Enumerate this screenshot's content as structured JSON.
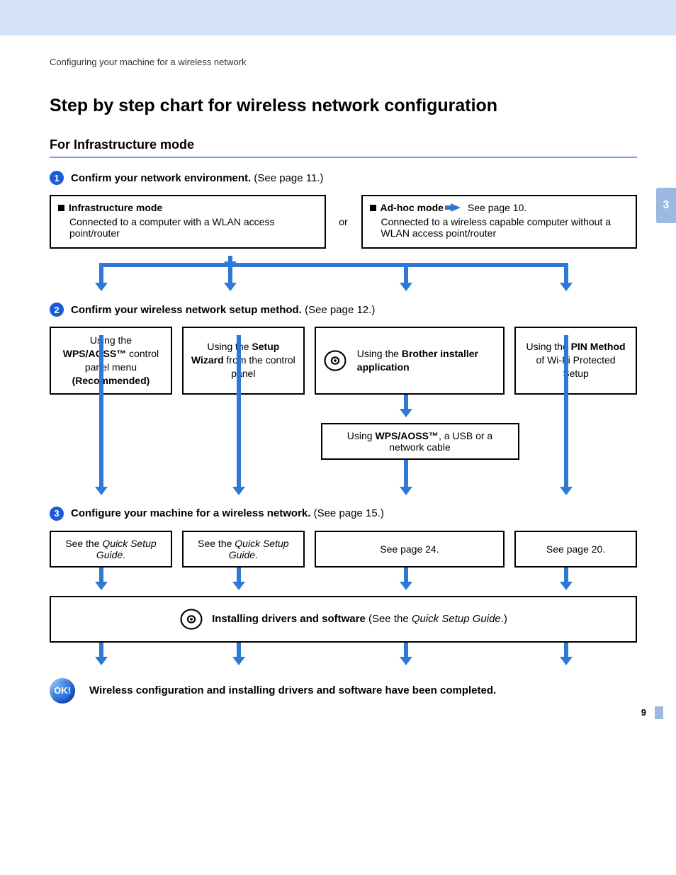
{
  "breadcrumb": "Configuring your machine for a wireless network",
  "page_title": "Step by step chart for wireless network configuration",
  "section_title": "For Infrastructure mode",
  "side_tab": "3",
  "page_number": "9",
  "step1": {
    "num": "1",
    "label_bold": "Confirm your network environment.",
    "label_rest": " (See page 11.)",
    "box_left_title": "Infrastructure mode",
    "box_left_body": "Connected to a computer with a WLAN access point/router",
    "or": "or",
    "box_right_title": "Ad-hoc mode",
    "box_right_see": " See page 10.",
    "box_right_body": "Connected to a wireless capable computer without a WLAN access point/router"
  },
  "step2": {
    "num": "2",
    "label_bold": "Confirm your wireless network setup method.",
    "label_rest": " (See page 12.)",
    "opt1_pre": "Using the ",
    "opt1_bold": "WPS/AOSS™",
    "opt1_mid": " control panel menu ",
    "opt1_rec": "(Recommended)",
    "opt2_pre": "Using the ",
    "opt2_bold": "Setup Wizard",
    "opt2_post": " from the control panel",
    "opt3_pre": "Using the ",
    "opt3_bold": "Brother installer application",
    "opt4_pre": "Using the ",
    "opt4_bold": "PIN Method",
    "opt4_post": " of Wi-Fi Protected Setup",
    "sub_pre": "Using ",
    "sub_bold": "WPS/AOSS™",
    "sub_post": ", a USB or a network cable"
  },
  "step3": {
    "num": "3",
    "label_bold": "Configure your machine for a wireless network.",
    "label_rest": " (See page 15.)",
    "c1_pre": "See the ",
    "c1_it": "Quick Setup Guide",
    "c1_post": ".",
    "c2_pre": "See the ",
    "c2_it": "Quick Setup Guide",
    "c2_post": ".",
    "c3": "See page 24.",
    "c4": "See page 20."
  },
  "install": {
    "bold": "Installing drivers and software",
    "rest_pre": " (See the ",
    "rest_it": "Quick Setup Guide",
    "rest_post": ".)"
  },
  "ok": {
    "badge": "OK!",
    "text": "Wireless configuration and installing drivers and software have been completed."
  }
}
